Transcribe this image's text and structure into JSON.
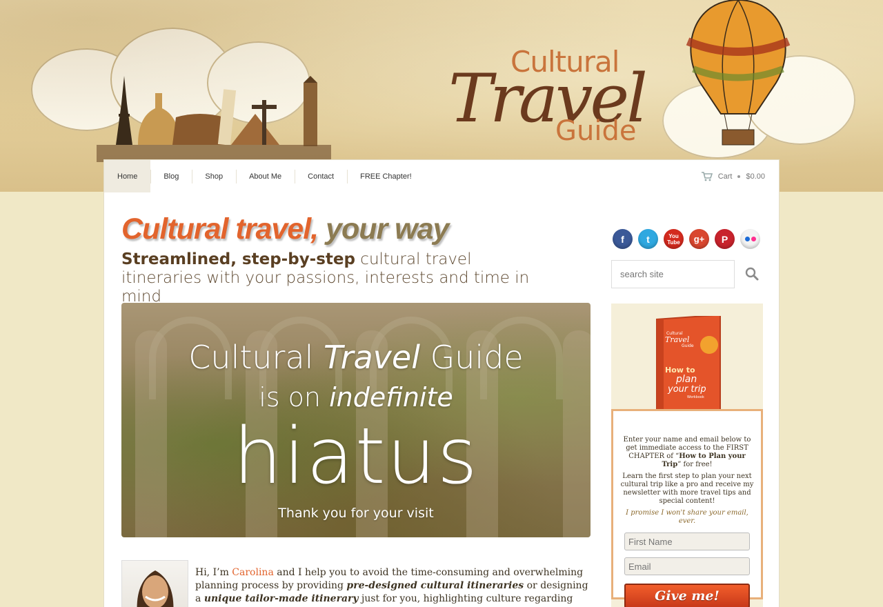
{
  "header": {
    "logo_line1": "Cultural",
    "logo_line2": "Travel",
    "logo_line3": "Guide"
  },
  "nav": {
    "items": [
      {
        "label": "Home",
        "active": true
      },
      {
        "label": "Blog"
      },
      {
        "label": "Shop"
      },
      {
        "label": "About Me"
      },
      {
        "label": "Contact"
      },
      {
        "label": "FREE Chapter!"
      }
    ],
    "cart_label": "Cart",
    "cart_total": "$0.00",
    "cart_icon": "cart-icon"
  },
  "main": {
    "headline_a": "Cultural travel,",
    "headline_b": "your way",
    "subhead_strong": "Streamlined, step-by-step",
    "subhead_rest": "cultural travel itineraries with your passions, interests and time in mind",
    "hero": {
      "line1_a": "Cultural",
      "line1_b": "Travel",
      "line1_c": "Guide",
      "line2_a": "is on",
      "line2_b": "indefinite",
      "line3": "hiatus",
      "line4": "Thank you for your visit"
    },
    "intro": {
      "pre": "Hi, I’m",
      "name": "Carolina",
      "t1": "and I help you to avoid the time-consuming and overwhelming planning process by providing",
      "b1": "pre-designed cultural itineraries",
      "t2": "or designing a",
      "b2": "unique tailor-made itinerary",
      "t3": "just for you, highlighting culture regarding history, art, science and"
    }
  },
  "sidebar": {
    "social": [
      {
        "name": "facebook-icon",
        "glyph": "f",
        "color": "#3b5998"
      },
      {
        "name": "twitter-icon",
        "glyph": "t",
        "color": "#2fa8e0"
      },
      {
        "name": "youtube-icon",
        "glyph": "You Tube",
        "color": "#d32a1e"
      },
      {
        "name": "google-plus-icon",
        "glyph": "g+",
        "color": "#d9472f"
      },
      {
        "name": "pinterest-icon",
        "glyph": "P",
        "color": "#c8232c"
      },
      {
        "name": "flickr-icon",
        "glyph": "••",
        "color": "#f3f3f3"
      }
    ],
    "search_placeholder": "search site",
    "optin": {
      "p1_a": "Enter your name and email below to get immediate access to the FIRST CHAPTER of “",
      "p1_b": "How to Plan your Trip",
      "p1_c": "” for free!",
      "p2": "Learn the first step to plan your next cultural trip like a pro and receive my newsletter with more travel tips and special content!",
      "p3": "I promise I won't share your email, ever.",
      "first_name_placeholder": "First Name",
      "email_placeholder": "Email",
      "button_label": "Give me!"
    },
    "book": {
      "title_a": "How to",
      "title_b": "plan",
      "title_c": "your trip",
      "subtitle": "Workbook",
      "logo_line1": "Cultural",
      "logo_line2": "Travel",
      "logo_line3": "Guide"
    }
  }
}
